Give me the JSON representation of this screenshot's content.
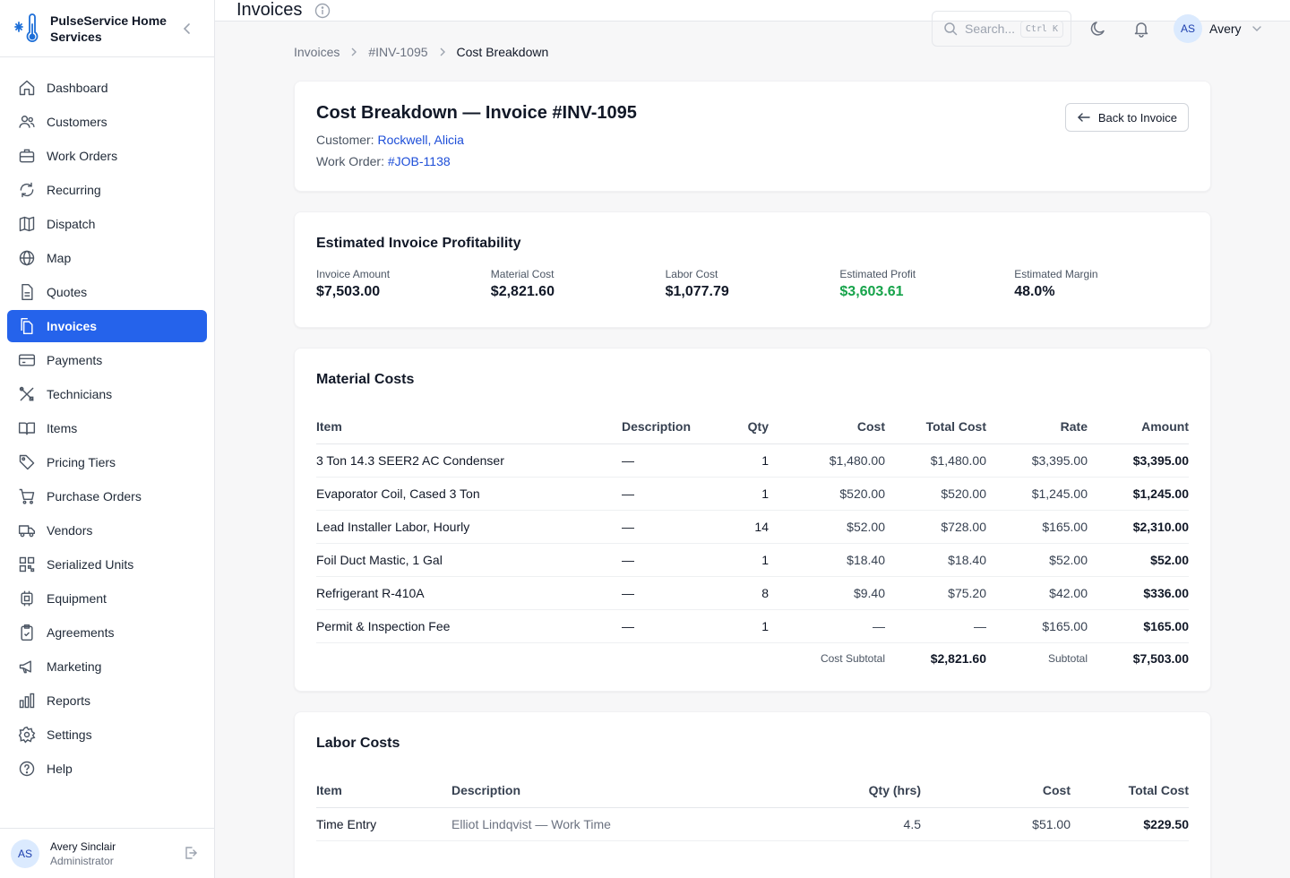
{
  "brand": {
    "name": "PulseService Home Services"
  },
  "nav": [
    {
      "id": "dashboard",
      "label": "Dashboard",
      "icon": "home-icon"
    },
    {
      "id": "customers",
      "label": "Customers",
      "icon": "users-icon"
    },
    {
      "id": "work-orders",
      "label": "Work Orders",
      "icon": "briefcase-icon"
    },
    {
      "id": "recurring",
      "label": "Recurring",
      "icon": "refresh-icon"
    },
    {
      "id": "dispatch",
      "label": "Dispatch",
      "icon": "map-folded-icon"
    },
    {
      "id": "map",
      "label": "Map",
      "icon": "globe-icon"
    },
    {
      "id": "quotes",
      "label": "Quotes",
      "icon": "document-icon"
    },
    {
      "id": "invoices",
      "label": "Invoices",
      "icon": "copy-document-icon",
      "active": true
    },
    {
      "id": "payments",
      "label": "Payments",
      "icon": "credit-card-icon"
    },
    {
      "id": "technicians",
      "label": "Technicians",
      "icon": "tools-icon"
    },
    {
      "id": "items",
      "label": "Items",
      "icon": "book-open-icon"
    },
    {
      "id": "pricing-tiers",
      "label": "Pricing Tiers",
      "icon": "tag-icon"
    },
    {
      "id": "purchase-orders",
      "label": "Purchase Orders",
      "icon": "cart-icon"
    },
    {
      "id": "vendors",
      "label": "Vendors",
      "icon": "truck-icon"
    },
    {
      "id": "serialized-units",
      "label": "Serialized Units",
      "icon": "qr-code-icon"
    },
    {
      "id": "equipment",
      "label": "Equipment",
      "icon": "chip-icon"
    },
    {
      "id": "agreements",
      "label": "Agreements",
      "icon": "clipboard-icon"
    },
    {
      "id": "marketing",
      "label": "Marketing",
      "icon": "megaphone-icon"
    },
    {
      "id": "reports",
      "label": "Reports",
      "icon": "bar-chart-icon"
    },
    {
      "id": "settings",
      "label": "Settings",
      "icon": "gear-icon"
    },
    {
      "id": "help",
      "label": "Help",
      "icon": "help-circle-icon"
    }
  ],
  "user": {
    "initials": "AS",
    "name": "Avery Sinclair",
    "role": "Administrator",
    "first_name": "Avery"
  },
  "topbar": {
    "title": "Invoices",
    "search_placeholder": "Search...",
    "shortcut": "Ctrl K"
  },
  "breadcrumb": [
    "Invoices",
    "#INV-1095",
    "Cost Breakdown"
  ],
  "header": {
    "title": "Cost Breakdown — Invoice #INV-1095",
    "customer_label": "Customer:",
    "customer_name": "Rockwell, Alicia",
    "work_order_label": "Work Order:",
    "work_order": "#JOB-1138",
    "back_label": "Back to Invoice"
  },
  "profitability": {
    "title": "Estimated Invoice Profitability",
    "stats": [
      {
        "label": "Invoice Amount",
        "value": "$7,503.00"
      },
      {
        "label": "Material Cost",
        "value": "$2,821.60"
      },
      {
        "label": "Labor Cost",
        "value": "$1,077.79"
      },
      {
        "label": "Estimated Profit",
        "value": "$3,603.61",
        "highlight": "#16a34a"
      },
      {
        "label": "Estimated Margin",
        "value": "48.0%"
      }
    ]
  },
  "materials": {
    "title": "Material Costs",
    "columns": [
      "Item",
      "Description",
      "Qty",
      "Cost",
      "Total Cost",
      "Rate",
      "Amount"
    ],
    "rows": [
      {
        "item": "3 Ton 14.3 SEER2 AC Condenser",
        "description": "—",
        "qty": "1",
        "cost": "$1,480.00",
        "total_cost": "$1,480.00",
        "rate": "$3,395.00",
        "amount": "$3,395.00"
      },
      {
        "item": "Evaporator Coil, Cased 3 Ton",
        "description": "—",
        "qty": "1",
        "cost": "$520.00",
        "total_cost": "$520.00",
        "rate": "$1,245.00",
        "amount": "$1,245.00"
      },
      {
        "item": "Lead Installer Labor, Hourly",
        "description": "—",
        "qty": "14",
        "cost": "$52.00",
        "total_cost": "$728.00",
        "rate": "$165.00",
        "amount": "$2,310.00"
      },
      {
        "item": "Foil Duct Mastic, 1 Gal",
        "description": "—",
        "qty": "1",
        "cost": "$18.40",
        "total_cost": "$18.40",
        "rate": "$52.00",
        "amount": "$52.00"
      },
      {
        "item": "Refrigerant R-410A",
        "description": "—",
        "qty": "8",
        "cost": "$9.40",
        "total_cost": "$75.20",
        "rate": "$42.00",
        "amount": "$336.00"
      },
      {
        "item": "Permit & Inspection Fee",
        "description": "—",
        "qty": "1",
        "cost": "—",
        "total_cost": "—",
        "rate": "$165.00",
        "amount": "$165.00"
      }
    ],
    "cost_subtotal_label": "Cost Subtotal",
    "cost_subtotal": "$2,821.60",
    "subtotal_label": "Subtotal",
    "subtotal": "$7,503.00"
  },
  "labor": {
    "title": "Labor Costs",
    "columns": [
      "Item",
      "Description",
      "Qty (hrs)",
      "Cost",
      "Total Cost"
    ],
    "rows": [
      {
        "item": "Time Entry",
        "description": "Elliot Lindqvist — Work Time",
        "qty": "4.5",
        "cost": "$51.00",
        "total_cost": "$229.50"
      }
    ]
  }
}
